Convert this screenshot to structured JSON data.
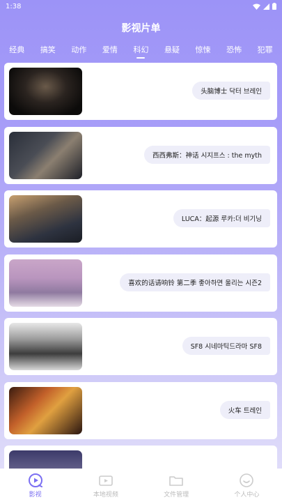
{
  "status": {
    "time": "1:38"
  },
  "header": {
    "title": "影视片单"
  },
  "tabs": [
    {
      "label": "经典"
    },
    {
      "label": "搞笑"
    },
    {
      "label": "动作"
    },
    {
      "label": "爱情"
    },
    {
      "label": "科幻"
    },
    {
      "label": "悬疑"
    },
    {
      "label": "惊悚"
    },
    {
      "label": "恐怖"
    },
    {
      "label": "犯罪"
    }
  ],
  "active_tab": "科幻",
  "movies": [
    {
      "title": "头脑博士 닥터 브레인"
    },
    {
      "title": "西西弗斯：神话 시지프스 : the myth"
    },
    {
      "title": "LUCA：起源 루카:더 비기닝"
    },
    {
      "title": "喜欢的话请响铃 第二季 좋아하면 울리는 시즌2"
    },
    {
      "title": "SF8 시네마틱드라마 SF8"
    },
    {
      "title": "火车 트레인"
    }
  ],
  "bottom_nav": [
    {
      "label": "影视",
      "icon": "play-circle-icon"
    },
    {
      "label": "本地视频",
      "icon": "video-camera-icon"
    },
    {
      "label": "文件管理",
      "icon": "folder-icon"
    },
    {
      "label": "个人中心",
      "icon": "smile-icon"
    }
  ],
  "colors": {
    "accent": "#7b6ff2",
    "inactive": "#bbbbbb"
  }
}
